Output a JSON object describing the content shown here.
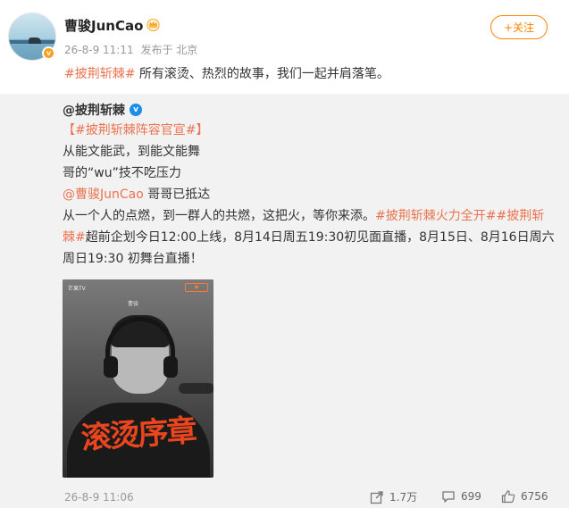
{
  "post": {
    "username": "曹骏JunCao",
    "badge_icon": "crown-icon",
    "time": "26-8-9 11:11",
    "source": "发布于 北京",
    "follow_label": "+关注",
    "topic": "#披荆斩棘#",
    "text": " 所有滚烫、热烈的故事，我们一起并肩落笔。"
  },
  "repost": {
    "author": "@披荆斩棘",
    "tag_line": "【#披荆斩棘阵容官宣#】",
    "line1": "从能文能武，到能文能舞",
    "line2": "哥的“wu”技不吃压力",
    "mention": "@曹骏JunCao",
    "mention_tail": " 哥哥已抵达",
    "para_start": "从一个人的点燃，到一群人的共燃，这把火，等你来添。",
    "topic2": "#披荆斩棘火力全开#",
    "topic3a": "#披荆斩",
    "topic3b": "棘#",
    "para_end": "超前企划今日12:00上线，8月14日周五19:30初见面直播，8月15日、8月16日周六",
    "para_last": "周日19:30 初舞台直播！",
    "poster_title": "滚烫序章",
    "poster_name": "曹骏",
    "poster_logo": "芒果TV"
  },
  "footer": {
    "time": "26-8-9 11:06",
    "share_count": "1.7万",
    "comment_count": "699",
    "like_count": "6756"
  },
  "colors": {
    "accent": "#ff8200",
    "topic": "#eb7350",
    "verified_blue": "#1b8ee8"
  }
}
